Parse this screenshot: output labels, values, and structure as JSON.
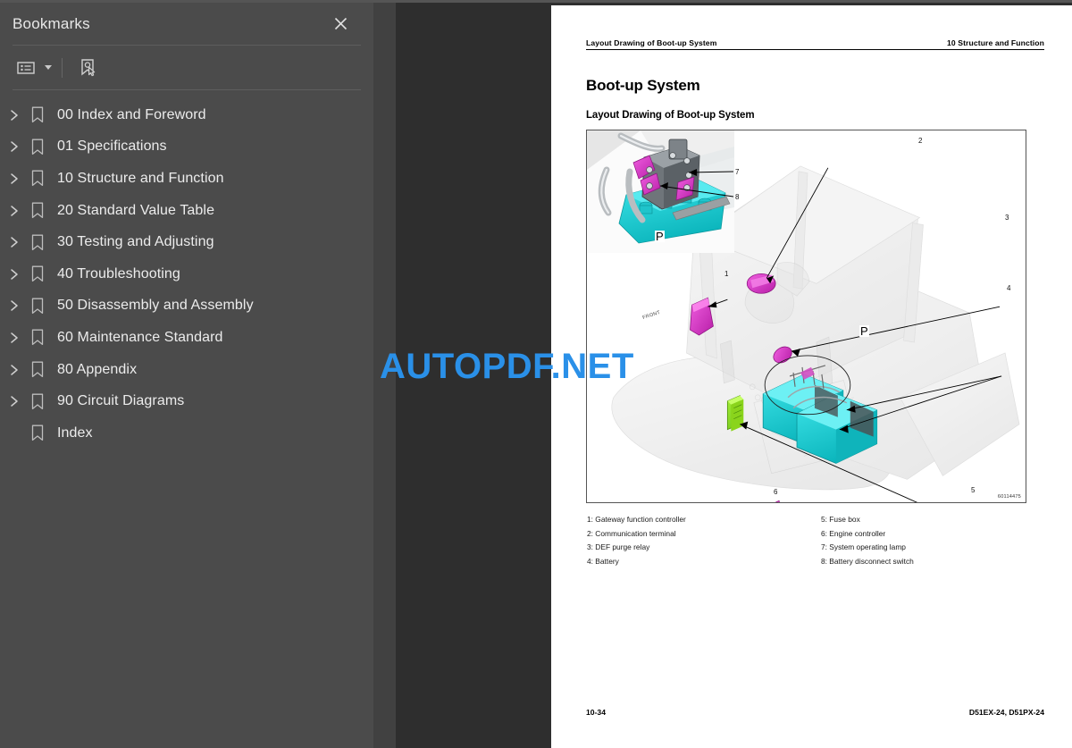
{
  "sidebar": {
    "title": "Bookmarks",
    "close_icon": "close-icon",
    "toolbar": {
      "options_icon": "list-options-icon",
      "options_caret_icon": "chevron-down-icon",
      "new_bookmark_icon": "new-bookmark-icon"
    },
    "items": [
      {
        "label": "00 Index and Foreword",
        "expandable": true,
        "icon": "bookmark-icon"
      },
      {
        "label": "01 Specifications",
        "expandable": true,
        "icon": "bookmark-icon"
      },
      {
        "label": "10 Structure and Function",
        "expandable": true,
        "icon": "bookmark-icon"
      },
      {
        "label": "20 Standard Value Table",
        "expandable": true,
        "icon": "bookmark-icon"
      },
      {
        "label": "30 Testing and Adjusting",
        "expandable": true,
        "icon": "bookmark-icon"
      },
      {
        "label": "40 Troubleshooting",
        "expandable": true,
        "icon": "bookmark-icon"
      },
      {
        "label": "50 Disassembly and Assembly",
        "expandable": true,
        "icon": "bookmark-icon"
      },
      {
        "label": "60 Maintenance Standard",
        "expandable": true,
        "icon": "bookmark-icon"
      },
      {
        "label": "80 Appendix",
        "expandable": true,
        "icon": "bookmark-icon"
      },
      {
        "label": "90 Circuit Diagrams",
        "expandable": true,
        "icon": "bookmark-icon"
      },
      {
        "label": "Index",
        "expandable": false,
        "icon": "bookmark-icon"
      }
    ]
  },
  "page": {
    "running_head_left": "Layout Drawing of Boot-up System",
    "running_head_right": "10 Structure and Function",
    "heading": "Boot-up System",
    "subheading": "Layout Drawing of Boot-up System",
    "figure": {
      "id_code": "60114475",
      "front_arrow_label": "FRONT",
      "port_marks": [
        "P",
        "P"
      ],
      "callouts": [
        "1",
        "2",
        "3",
        "4",
        "5",
        "6",
        "7",
        "8"
      ]
    },
    "legend": {
      "left": [
        "1: Gateway function controller",
        "2: Communication terminal",
        "3: DEF purge relay",
        "4: Battery"
      ],
      "right": [
        "5: Fuse box",
        "6: Engine controller",
        "7: System operating lamp",
        "8: Battery disconnect switch"
      ]
    },
    "footer_left": "10-34",
    "footer_right": "D51EX-24, D51PX-24"
  },
  "watermark": {
    "text": "AUTOPDF.NET",
    "color": "#2a90e8"
  },
  "colors": {
    "sidebar_bg": "#4b4b4b",
    "splitter_bg": "#414141",
    "viewer_bg": "#2e2e2e",
    "page_bg": "#ffffff",
    "highlight_magenta": "#e23fd0",
    "highlight_cyan": "#1ad1d8",
    "highlight_green": "#7ddb20"
  }
}
